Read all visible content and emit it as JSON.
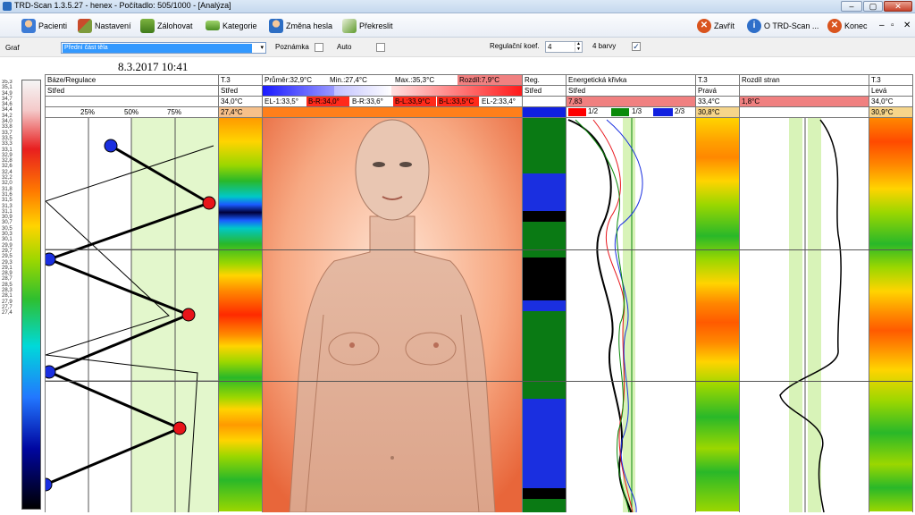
{
  "window": {
    "title": "TRD-Scan 1.3.5.27  -  henex - Počítadlo: 505/1000 - [Analýza]",
    "controls": [
      "–",
      "▢",
      "✕"
    ]
  },
  "toolbar": {
    "items": [
      {
        "label": "Pacienti",
        "icon": "patients-icon"
      },
      {
        "label": "Nastavení",
        "icon": "settings-icon"
      },
      {
        "label": "Zálohovat",
        "icon": "backup-icon"
      },
      {
        "label": "Kategorie",
        "icon": "category-icon"
      },
      {
        "label": "Změna hesla",
        "icon": "password-icon"
      },
      {
        "label": "Překreslit",
        "icon": "redraw-icon"
      }
    ],
    "right_items": [
      {
        "label": "Zavřít",
        "icon": "close-circle-icon"
      },
      {
        "label": "O TRD-Scan ...",
        "icon": "info-icon"
      },
      {
        "label": "Konec",
        "icon": "exit-icon"
      }
    ],
    "mdi_controls": [
      "–",
      "▫",
      "✕"
    ]
  },
  "options": {
    "graf_label": "Graf",
    "graf_value": "Přední část těla",
    "poznamka_label": "Poznámka",
    "auto_label": "Auto",
    "reg_koef_label": "Regulační koef.",
    "reg_koef_value": "4",
    "barvy_label": "4 barvy",
    "barvy_checked": "✓"
  },
  "datetime": "8.3.2017 10:41",
  "scale_ticks": [
    "35,3",
    "35,1",
    "34,9",
    "34,7",
    "34,6",
    "34,4",
    "34,2",
    "34,0",
    "33,8",
    "33,7",
    "33,5",
    "33,3",
    "33,1",
    "32,9",
    "32,8",
    "32,6",
    "32,4",
    "32,2",
    "32,0",
    "31,8",
    "31,6",
    "31,5",
    "31,3",
    "31,1",
    "30,9",
    "30,7",
    "30,5",
    "30,3",
    "30,1",
    "29,9",
    "29,7",
    "29,5",
    "29,3",
    "29,1",
    "28,9",
    "28,7",
    "28,5",
    "28,3",
    "28,1",
    "27,9",
    "27,7",
    "27,4"
  ],
  "base_panel": {
    "title": "Báze/Regulace",
    "subtitle": "Střed",
    "percent_labels": [
      "25%",
      "50%",
      "75%"
    ]
  },
  "col_t3_mid": {
    "title": "T.3",
    "sub": "Střed",
    "v1": "34,0°C",
    "v2": "27,4°C"
  },
  "stats": {
    "prumer": "Průměr:32,9°C",
    "min": "Min.:27,4°C",
    "max": "Max.:35,3°C",
    "rozdil": "Rozdíl:7,9°C",
    "cells": [
      "EL-1:33,5°",
      "B-R:34,0°",
      "B-R:33,6°",
      "B-L:33,9°C",
      "B-L:33,5°C",
      "EL-2:33,4°"
    ]
  },
  "reg_col": {
    "title": "Reg.",
    "sub": "Střed"
  },
  "energy": {
    "title": "Energetická křivka",
    "sub": "Střed",
    "value": "7,83",
    "legend": [
      "1/2",
      "1/3",
      "2/3"
    ]
  },
  "col_t3_right": {
    "title": "T.3",
    "sub": "Pravá",
    "v1": "33,4°C",
    "v2": "30,8°C"
  },
  "rozdil_stran": {
    "title": "Rozdíl stran",
    "value": "1,8°C"
  },
  "col_t3_left": {
    "title": "T.3",
    "sub": "Levá",
    "v1": "34,0°C",
    "v2": "30,9°C"
  },
  "colors": {
    "accent": "#3399ff",
    "warn": "#f08080",
    "green_band": "#e3f7cc"
  }
}
